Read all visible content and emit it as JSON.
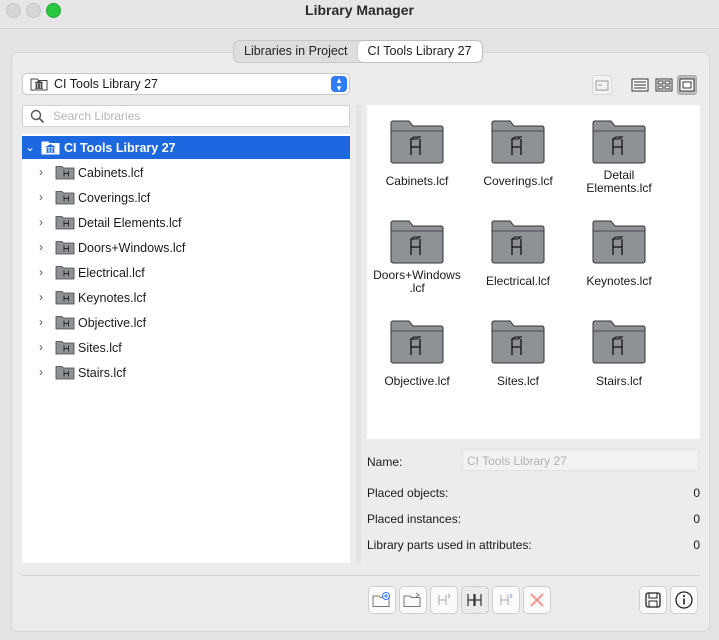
{
  "window": {
    "title": "Library Manager"
  },
  "tabs": [
    {
      "label": "Libraries in Project",
      "active": false
    },
    {
      "label": "CI Tools Library 27",
      "active": true
    }
  ],
  "library_select": {
    "value": "CI Tools Library 27"
  },
  "search": {
    "placeholder": "Search Libraries",
    "value": ""
  },
  "tree": {
    "root": {
      "label": "CI Tools Library 27",
      "expanded": true
    },
    "items": [
      {
        "label": "Cabinets.lcf"
      },
      {
        "label": "Coverings.lcf"
      },
      {
        "label": "Detail Elements.lcf"
      },
      {
        "label": "Doors+Windows.lcf"
      },
      {
        "label": "Electrical.lcf"
      },
      {
        "label": "Keynotes.lcf"
      },
      {
        "label": "Objective.lcf"
      },
      {
        "label": "Sites.lcf"
      },
      {
        "label": "Stairs.lcf"
      }
    ]
  },
  "grid": {
    "items": [
      {
        "line1": "Cabinets.lcf",
        "line2": ""
      },
      {
        "line1": "Coverings.lcf",
        "line2": ""
      },
      {
        "line1": "Detail",
        "line2": "Elements.lcf"
      },
      {
        "line1": "Doors+Windows",
        "line2": ".lcf"
      },
      {
        "line1": "Electrical.lcf",
        "line2": ""
      },
      {
        "line1": "Keynotes.lcf",
        "line2": ""
      },
      {
        "line1": "Objective.lcf",
        "line2": ""
      },
      {
        "line1": "Sites.lcf",
        "line2": ""
      },
      {
        "line1": "Stairs.lcf",
        "line2": ""
      }
    ]
  },
  "info": {
    "name_label": "Name:",
    "name_placeholder": "CI Tools Library 27",
    "placed_objects_label": "Placed objects:",
    "placed_objects_value": "0",
    "placed_instances_label": "Placed instances:",
    "placed_instances_value": "0",
    "library_parts_label": "Library parts used in attributes:",
    "library_parts_value": "0"
  },
  "colors": {
    "accent": "#1b68e0",
    "folder": "#8e9196",
    "close": "#d8d8d8",
    "zoom": "#28c840"
  },
  "icons": {
    "view_list": "list-view-icon",
    "view_grid": "grid-view-icon",
    "view_large": "large-icon-view-icon",
    "delete": "delete-x-icon"
  }
}
